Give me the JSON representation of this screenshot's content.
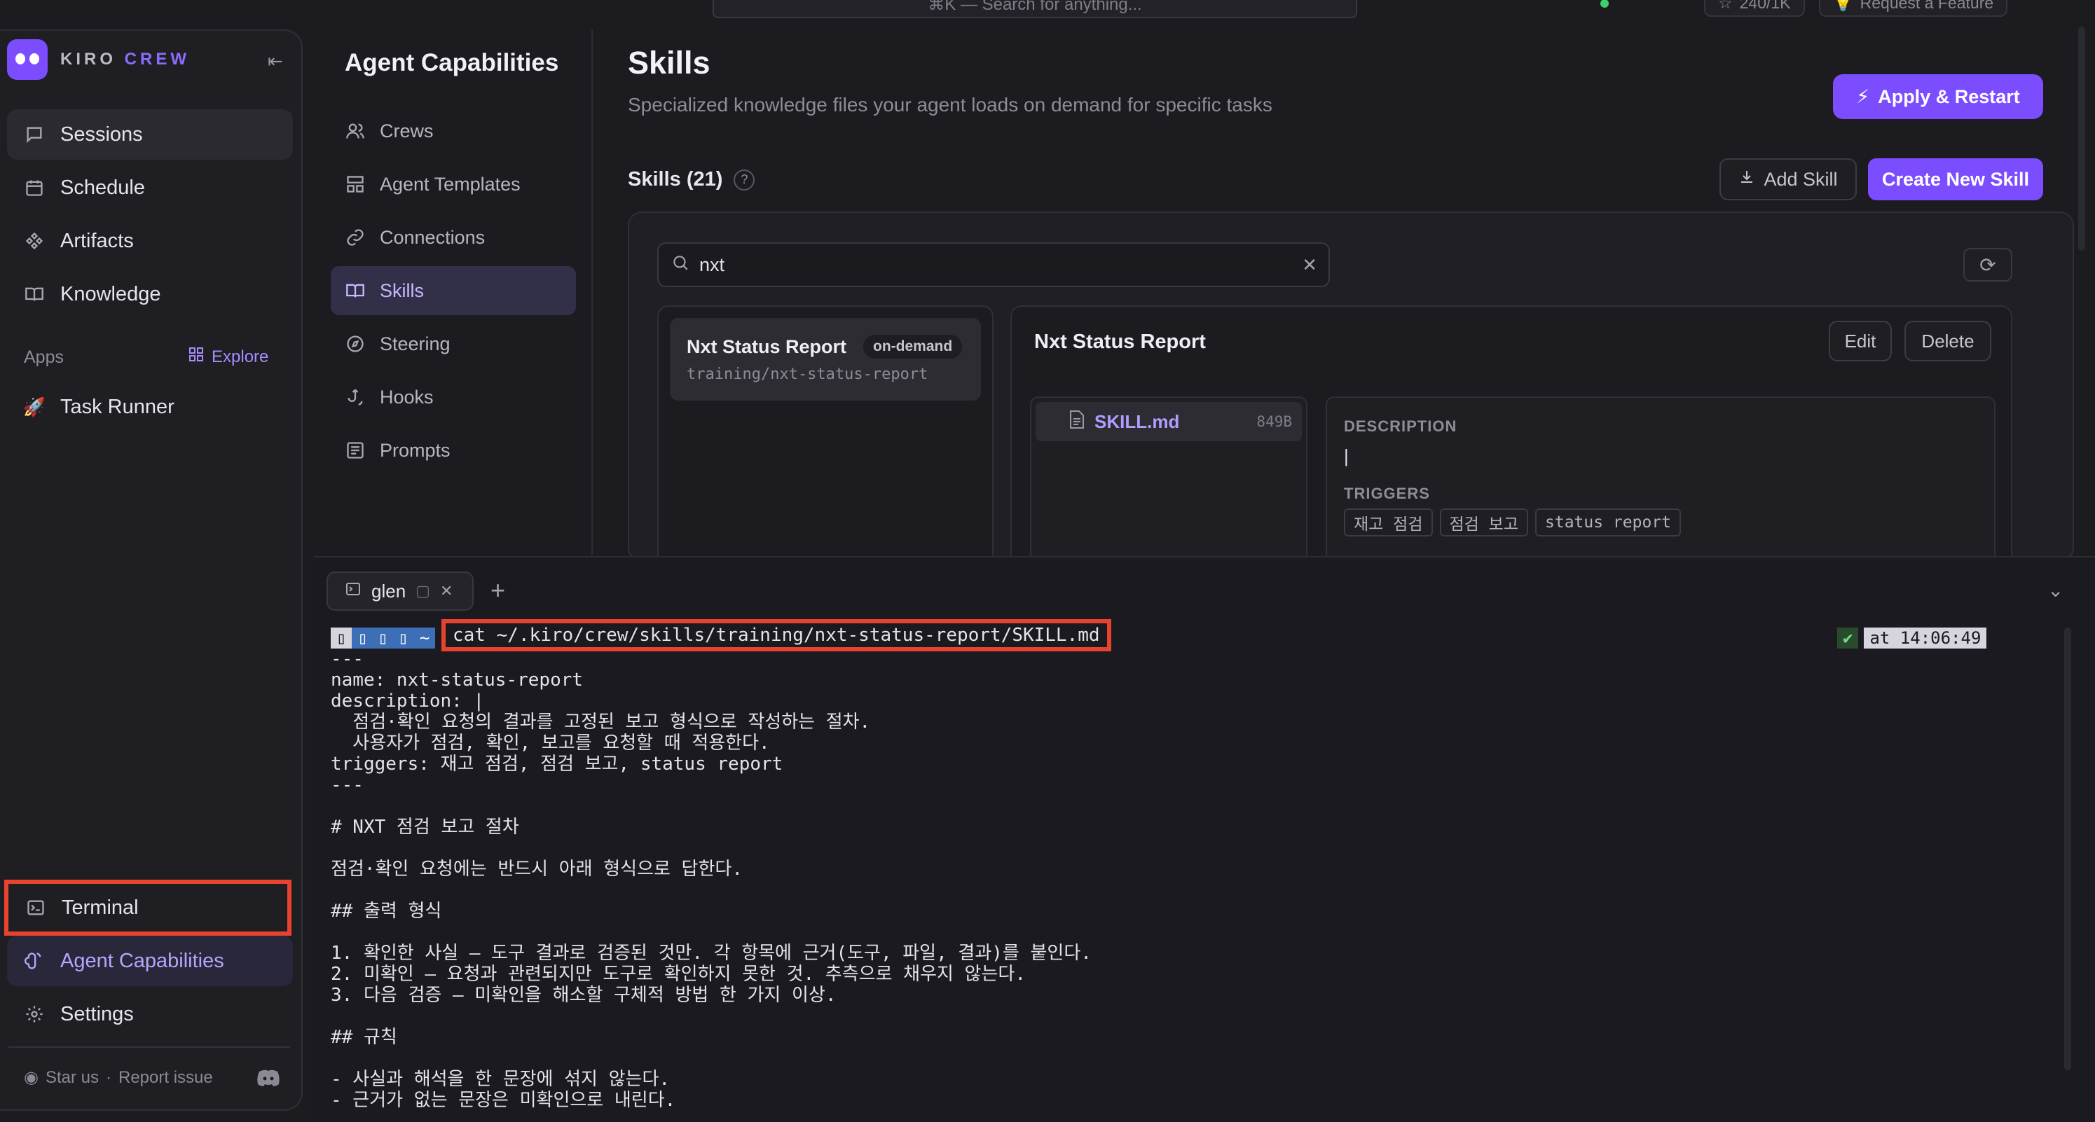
{
  "topbar": {
    "search_placeholder": "⌘K — Search for anything...",
    "stars_label": "240/1K",
    "feature_label": "Request a Feature"
  },
  "sidebar": {
    "brand_kiro": "KIRO",
    "brand_crew": "CREW",
    "items": [
      {
        "label": "Sessions",
        "icon": "chat-bubble-icon"
      },
      {
        "label": "Schedule",
        "icon": "calendar-icon"
      },
      {
        "label": "Artifacts",
        "icon": "artifacts-icon"
      },
      {
        "label": "Knowledge",
        "icon": "book-icon"
      }
    ],
    "apps_label": "Apps",
    "explore_label": "Explore",
    "apps": [
      {
        "label": "Task Runner",
        "icon": "rocket-icon"
      }
    ],
    "bottom_items": [
      {
        "label": "Terminal",
        "icon": "terminal-icon"
      },
      {
        "label": "Agent Capabilities",
        "icon": "brain-icon"
      },
      {
        "label": "Settings",
        "icon": "gear-icon"
      }
    ],
    "footer_star": "Star us",
    "footer_sep": "·",
    "footer_report": "Report issue"
  },
  "capabilities": {
    "title": "Agent Capabilities",
    "items": [
      {
        "label": "Crews",
        "icon": "users-icon"
      },
      {
        "label": "Agent Templates",
        "icon": "template-icon"
      },
      {
        "label": "Connections",
        "icon": "link-icon"
      },
      {
        "label": "Skills",
        "icon": "book-open-icon"
      },
      {
        "label": "Steering",
        "icon": "compass-icon"
      },
      {
        "label": "Hooks",
        "icon": "hook-icon"
      },
      {
        "label": "Prompts",
        "icon": "prompt-icon"
      }
    ]
  },
  "main": {
    "title": "Skills",
    "subtitle": "Specialized knowledge files your agent loads on demand for specific tasks",
    "apply_label": "Apply & Restart",
    "skills_count_label": "Skills (21)",
    "help_symbol": "?",
    "add_skill_label": "Add Skill",
    "create_label": "Create New Skill",
    "search_value": "nxt",
    "skill_card": {
      "name": "Nxt Status Report",
      "badge": "on-demand",
      "path": "training/nxt-status-report"
    },
    "detail": {
      "title": "Nxt Status Report",
      "edit_label": "Edit",
      "delete_label": "Delete",
      "file_name": "SKILL.md",
      "file_size": "849B",
      "description_label": "DESCRIPTION",
      "description_value": "|",
      "triggers_label": "TRIGGERS",
      "triggers": [
        "재고 점검",
        "점검 보고",
        "status report"
      ]
    }
  },
  "terminal": {
    "tab_label": "glen",
    "prompt_segments": [
      "",
      "",
      "",
      "~"
    ],
    "command": "cat ~/.kiro/crew/skills/training/nxt-status-report/SKILL.md",
    "right_prompt_check": "✔",
    "right_prompt_time": "at 14:06:49",
    "output_lines": [
      "---",
      "name: nxt-status-report",
      "description: |",
      "  점검·확인 요청의 결과를 고정된 보고 형식으로 작성하는 절차.",
      "  사용자가 점검, 확인, 보고를 요청할 때 적용한다.",
      "triggers: 재고 점검, 점검 보고, status report",
      "---",
      "",
      "# NXT 점검 보고 절차",
      "",
      "점검·확인 요청에는 반드시 아래 형식으로 답한다.",
      "",
      "## 출력 형식",
      "",
      "1. 확인한 사실 — 도구 결과로 검증된 것만. 각 항목에 근거(도구, 파일, 결과)를 붙인다.",
      "2. 미확인 — 요청과 관련되지만 도구로 확인하지 못한 것. 추측으로 채우지 않는다.",
      "3. 다음 검증 — 미확인을 해소할 구체적 방법 한 가지 이상.",
      "",
      "## 규칙",
      "",
      "- 사실과 해석을 한 문장에 섞지 않는다.",
      "- 근거가 없는 문장은 미확인으로 내린다."
    ]
  }
}
